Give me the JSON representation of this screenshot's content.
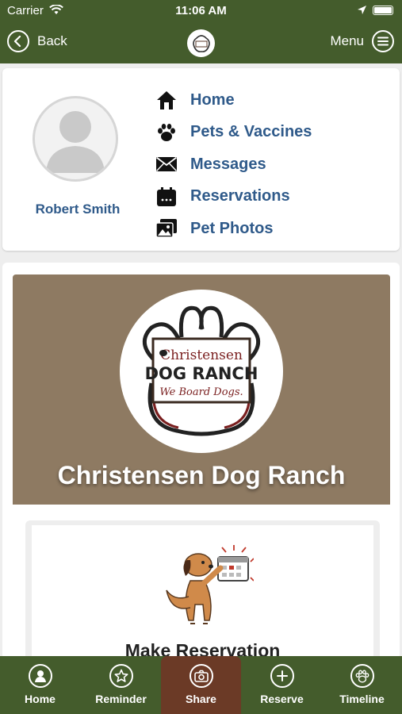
{
  "status_bar": {
    "carrier": "Carrier",
    "time": "11:06 AM"
  },
  "nav": {
    "back_label": "Back",
    "menu_label": "Menu"
  },
  "profile": {
    "name": "Robert Smith",
    "menu": [
      {
        "label": "Home",
        "icon": "home-icon"
      },
      {
        "label": "Pets & Vaccines",
        "icon": "paw-icon"
      },
      {
        "label": "Messages",
        "icon": "envelope-icon"
      },
      {
        "label": "Reservations",
        "icon": "calendar-icon"
      },
      {
        "label": "Pet Photos",
        "icon": "photos-icon"
      }
    ]
  },
  "banner": {
    "title": "Christensen Dog Ranch",
    "logo": {
      "line1": "Christensen",
      "line2": "DOG RANCH",
      "line3": "We Board Dogs."
    }
  },
  "reservation_card": {
    "label": "Make Reservation"
  },
  "tabs": [
    {
      "label": "Home",
      "icon": "person-icon",
      "active": false
    },
    {
      "label": "Reminder",
      "icon": "star-icon",
      "active": false
    },
    {
      "label": "Share",
      "icon": "camera-icon",
      "active": true
    },
    {
      "label": "Reserve",
      "icon": "plus-icon",
      "active": false
    },
    {
      "label": "Timeline",
      "icon": "paw-icon",
      "active": false
    }
  ],
  "colors": {
    "header_green": "#445c2c",
    "link_blue": "#2f5a8a",
    "banner_brown": "#8e7a62",
    "active_tab": "#6b3a26"
  }
}
